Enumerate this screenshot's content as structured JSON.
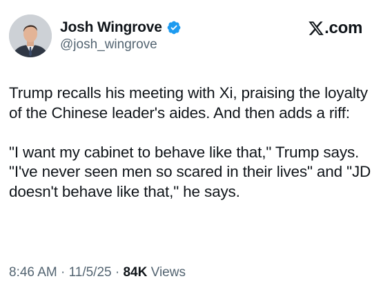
{
  "author": {
    "display_name": "Josh Wingrove",
    "handle": "@josh_wingrove",
    "verified_icon": "verified-badge-icon",
    "verified_color": "#1d9bf0"
  },
  "brand": {
    "text": ".com",
    "logo_icon": "x-logo-icon"
  },
  "tweet": {
    "paragraph_1": "Trump recalls his meeting with Xi, praising the loyalty of the Chinese leader's aides. And then adds a riff:",
    "paragraph_2": "\"I want my cabinet to behave like that,\" Trump says. \"I've never seen men so scared in their lives\" and \"JD doesn't behave like that,\" he says."
  },
  "meta": {
    "time": "8:46 AM",
    "separator": "·",
    "date": "11/5/25",
    "views_count": "84K",
    "views_label": "Views"
  },
  "colors": {
    "text_primary": "#0f1419",
    "text_secondary": "#536471",
    "background": "#ffffff"
  }
}
